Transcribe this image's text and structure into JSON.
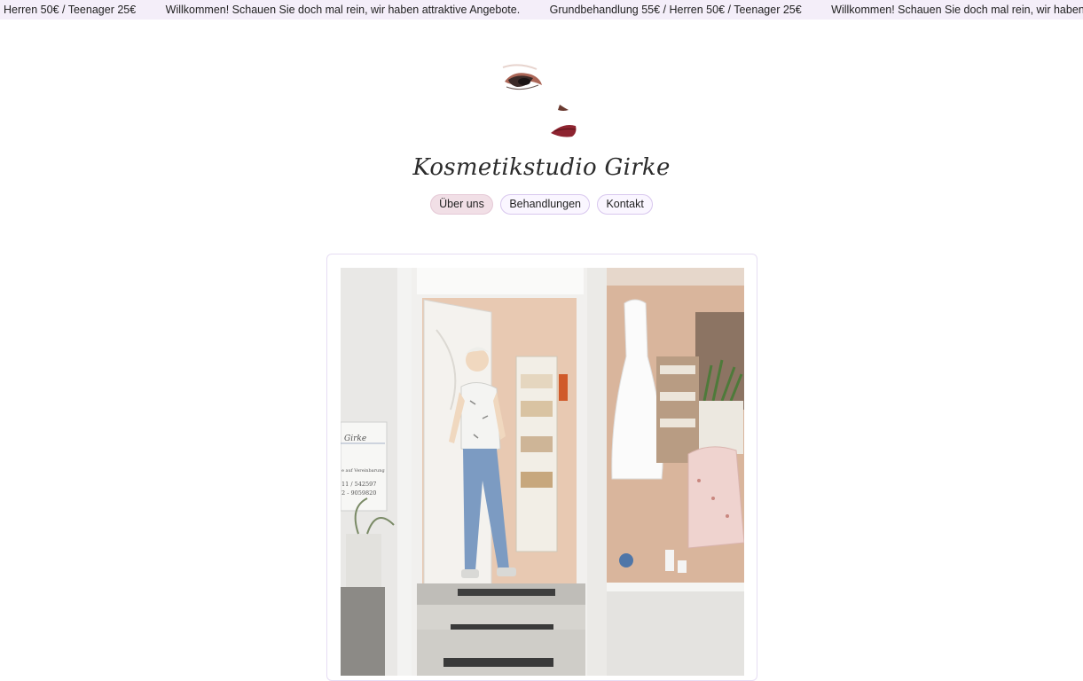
{
  "ticker": {
    "items": [
      "Herren 50€ / Teenager 25€",
      "Willkommen! Schauen Sie doch mal rein, wir haben attraktive Angebote.",
      "Grundbehandlung 55€ / Herren 50€ / Teenager 25€",
      "Willkommen! Schauen Sie doch mal rein, wir haben attraktive Angebote."
    ]
  },
  "site": {
    "title": "Kosmetikstudio Girke"
  },
  "nav": [
    {
      "label": "Über uns",
      "active": true
    },
    {
      "label": "Behandlungen",
      "active": false
    },
    {
      "label": "Kontakt",
      "active": false
    }
  ],
  "photo": {
    "sign": {
      "name": "Girke",
      "line1": "e auf Vereinbarung",
      "line2": "11 / 542597",
      "line3": "2 - 9059820"
    }
  },
  "colors": {
    "ticker_bg": "#f4eef9",
    "pill_border": "#d8c7ee",
    "pill_active": "#f1dfe6"
  }
}
